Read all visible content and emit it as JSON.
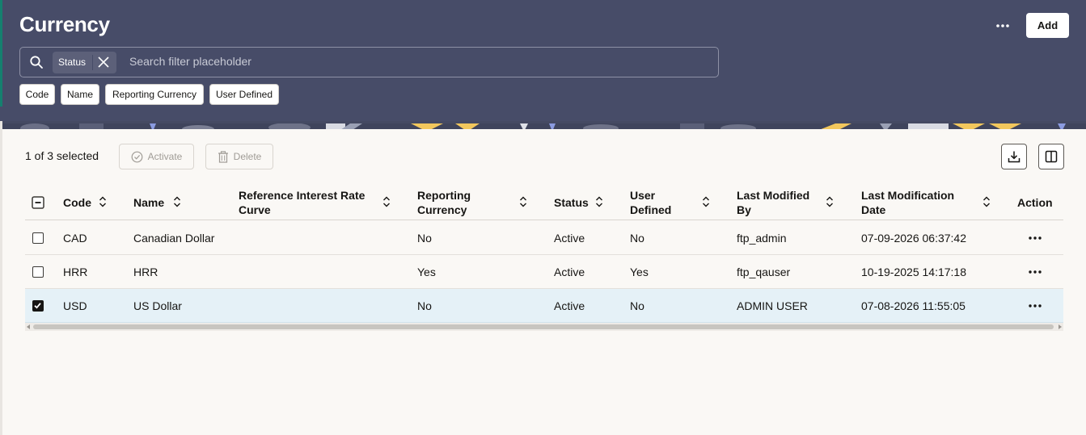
{
  "page": {
    "title": "Currency"
  },
  "header": {
    "add_label": "Add",
    "more_icon": "more-horizontal-icon"
  },
  "search": {
    "placeholder": "Search filter placeholder",
    "chip_label": "Status",
    "filters": [
      "Code",
      "Name",
      "Reporting Currency",
      "User Defined"
    ]
  },
  "toolbar": {
    "selection_text": "1 of 3 selected",
    "activate_label": "Activate",
    "delete_label": "Delete",
    "download_icon": "download-icon",
    "columns_icon": "columns-icon"
  },
  "table": {
    "columns": {
      "code": "Code",
      "name": "Name",
      "ref_rate_line1": "Reference Interest Rate",
      "ref_rate_line2": "Curve",
      "reporting_line1": "Reporting",
      "reporting_line2": "Currency",
      "status": "Status",
      "user_def_line1": "User",
      "user_def_line2": "Defined",
      "last_mod_by_line1": "Last Modified",
      "last_mod_by_line2": "By",
      "last_mod_date_line1": "Last Modification",
      "last_mod_date_line2": "Date",
      "action": "Action"
    },
    "rows": [
      {
        "code": "CAD",
        "name": "Canadian Dollar",
        "ref_rate": "",
        "reporting": "No",
        "status": "Active",
        "user_defined": "No",
        "modified_by": "ftp_admin",
        "modified_date": "07-09-2026 06:37:42",
        "selected": false
      },
      {
        "code": "HRR",
        "name": "HRR",
        "ref_rate": "",
        "reporting": "Yes",
        "status": "Active",
        "user_defined": "Yes",
        "modified_by": "ftp_qauser",
        "modified_date": "10-19-2025 14:17:18",
        "selected": false
      },
      {
        "code": "USD",
        "name": "US Dollar",
        "ref_rate": "",
        "reporting": "No",
        "status": "Active",
        "user_defined": "No",
        "modified_by": "ADMIN USER",
        "modified_date": "07-08-2026 11:55:05",
        "selected": true
      }
    ]
  },
  "colors": {
    "header_bg": "#474c68",
    "selected_row": "#e5f1f7",
    "accent_edge": "#15806f"
  }
}
